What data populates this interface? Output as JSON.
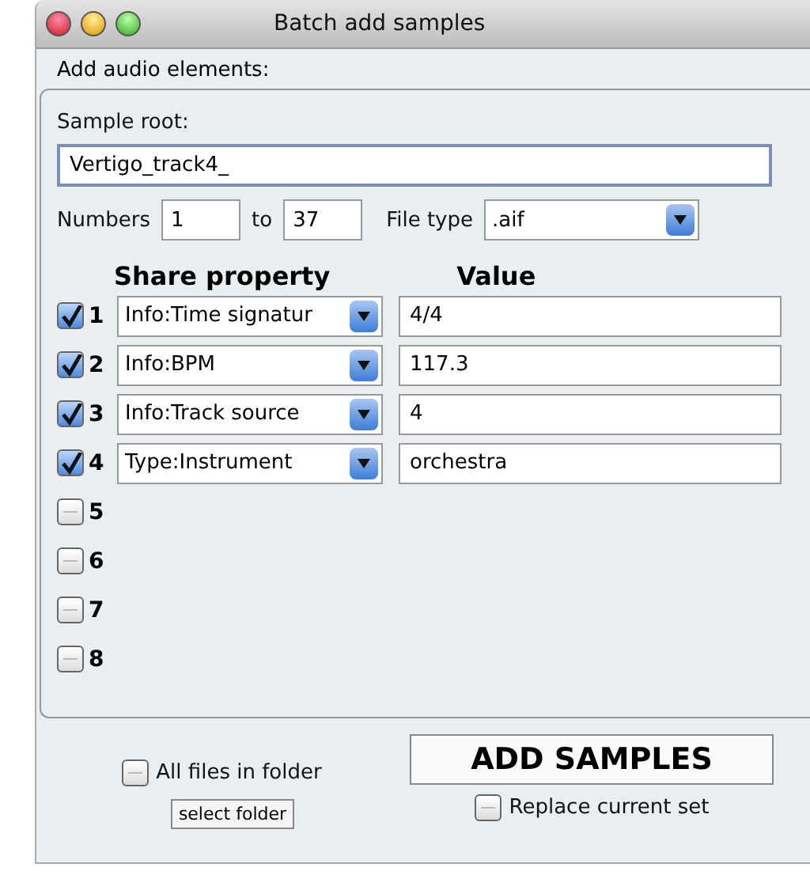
{
  "window": {
    "title": "Batch add samples"
  },
  "group": {
    "label": "Add audio elements:"
  },
  "sample_root": {
    "label": "Sample root:",
    "value": "Vertigo_track4_"
  },
  "numbers": {
    "label": "Numbers",
    "from": "1",
    "to_label": "to",
    "to": "37"
  },
  "file_type": {
    "label": "File type",
    "value": ".aif"
  },
  "headers": {
    "property": "Share property",
    "value": "Value"
  },
  "rows": [
    {
      "number": "1",
      "checked": true,
      "property": "Info:Time signatur",
      "value": "4/4"
    },
    {
      "number": "2",
      "checked": true,
      "property": "Info:BPM",
      "value": "117.3"
    },
    {
      "number": "3",
      "checked": true,
      "property": "Info:Track source",
      "value": "4"
    },
    {
      "number": "4",
      "checked": true,
      "property": "Type:Instrument",
      "value": "orchestra"
    },
    {
      "number": "5",
      "checked": false
    },
    {
      "number": "6",
      "checked": false
    },
    {
      "number": "7",
      "checked": false
    },
    {
      "number": "8",
      "checked": false
    }
  ],
  "all_files": {
    "label": "All files in folder",
    "checked": false
  },
  "select_folder": "select folder",
  "add_button": "ADD SAMPLES",
  "replace": {
    "label": "Replace current set",
    "checked": false
  }
}
